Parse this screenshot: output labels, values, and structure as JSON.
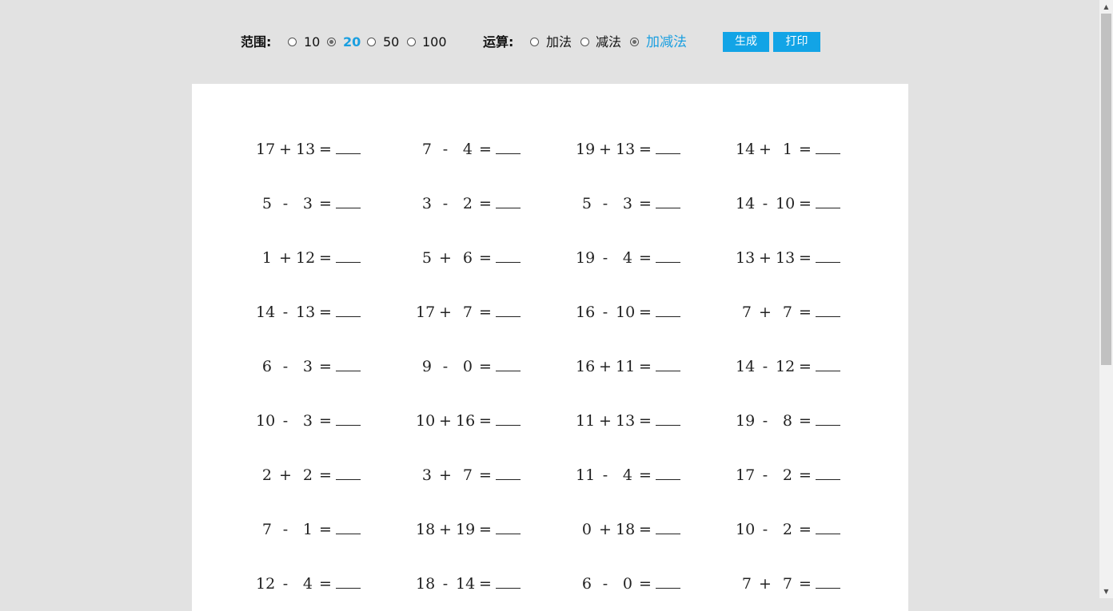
{
  "toolbar": {
    "range_label": "范围:",
    "range_options": [
      "10",
      "20",
      "50",
      "100"
    ],
    "range_selected_index": 1,
    "op_label": "运算:",
    "op_options": [
      "加法",
      "减法",
      "加减法"
    ],
    "op_selected_index": 2,
    "generate_label": "生成",
    "print_label": "打印",
    "accent_color": "#12a4e6"
  },
  "problems": [
    [
      [
        "17",
        "+",
        "13"
      ],
      [
        "7",
        "-",
        "4"
      ],
      [
        "19",
        "+",
        "13"
      ],
      [
        "14",
        "+",
        "1"
      ]
    ],
    [
      [
        "5",
        "-",
        "3"
      ],
      [
        "3",
        "-",
        "2"
      ],
      [
        "5",
        "-",
        "3"
      ],
      [
        "14",
        "-",
        "10"
      ]
    ],
    [
      [
        "1",
        "+",
        "12"
      ],
      [
        "5",
        "+",
        "6"
      ],
      [
        "19",
        "-",
        "4"
      ],
      [
        "13",
        "+",
        "13"
      ]
    ],
    [
      [
        "14",
        "-",
        "13"
      ],
      [
        "17",
        "+",
        "7"
      ],
      [
        "16",
        "-",
        "10"
      ],
      [
        "7",
        "+",
        "7"
      ]
    ],
    [
      [
        "6",
        "-",
        "3"
      ],
      [
        "9",
        "-",
        "0"
      ],
      [
        "16",
        "+",
        "11"
      ],
      [
        "14",
        "-",
        "12"
      ]
    ],
    [
      [
        "10",
        "-",
        "3"
      ],
      [
        "10",
        "+",
        "16"
      ],
      [
        "11",
        "+",
        "13"
      ],
      [
        "19",
        "-",
        "8"
      ]
    ],
    [
      [
        "2",
        "+",
        "2"
      ],
      [
        "3",
        "+",
        "7"
      ],
      [
        "11",
        "-",
        "4"
      ],
      [
        "17",
        "-",
        "2"
      ]
    ],
    [
      [
        "7",
        "-",
        "1"
      ],
      [
        "18",
        "+",
        "19"
      ],
      [
        "0",
        "+",
        "18"
      ],
      [
        "10",
        "-",
        "2"
      ]
    ],
    [
      [
        "12",
        "-",
        "4"
      ],
      [
        "18",
        "-",
        "14"
      ],
      [
        "6",
        "-",
        "0"
      ],
      [
        "7",
        "+",
        "7"
      ]
    ]
  ],
  "equals_sign": "=",
  "scrollbar": {
    "up_icon": "triangle-up",
    "down_icon": "triangle-down"
  }
}
